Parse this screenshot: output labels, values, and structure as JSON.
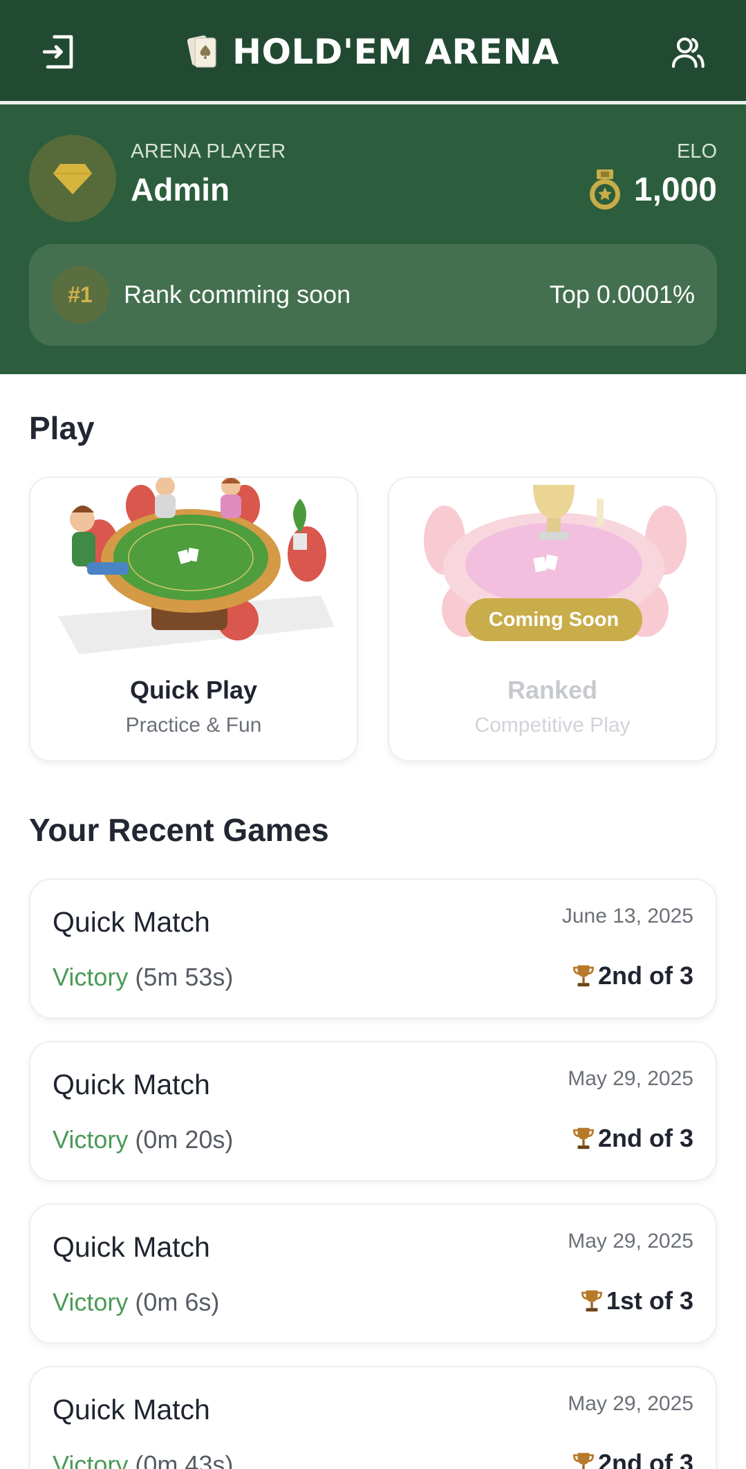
{
  "header": {
    "title": "HOLD'EM ARENA",
    "exit_icon": "exit-icon",
    "user_icon": "users-icon",
    "logo_icon": "card-spade-icon"
  },
  "profile": {
    "player_label": "ARENA PLAYER",
    "player_name": "Admin",
    "avatar_icon": "diamond-icon",
    "elo_label": "ELO",
    "elo_value": "1,000",
    "elo_icon": "medal-icon",
    "rank_badge": "#1",
    "rank_text": "Rank comming soon",
    "rank_top": "Top 0.0001%"
  },
  "play": {
    "section_title": "Play",
    "cards": [
      {
        "title": "Quick Play",
        "subtitle": "Practice & Fun"
      },
      {
        "title": "Ranked",
        "subtitle": "Competitive Play",
        "badge": "Coming Soon"
      }
    ]
  },
  "recent": {
    "section_title": "Your Recent Games",
    "games": [
      {
        "title": "Quick Match",
        "date": "June 13, 2025",
        "result": "Victory",
        "duration": "(5m 53s)",
        "place": "2nd of 3"
      },
      {
        "title": "Quick Match",
        "date": "May 29, 2025",
        "result": "Victory",
        "duration": "(0m 20s)",
        "place": "2nd of 3"
      },
      {
        "title": "Quick Match",
        "date": "May 29, 2025",
        "result": "Victory",
        "duration": "(0m 6s)",
        "place": "1st of 3"
      },
      {
        "title": "Quick Match",
        "date": "May 29, 2025",
        "result": "Victory",
        "duration": "(0m 43s)",
        "place": "2nd of 3"
      }
    ]
  },
  "colors": {
    "header_bg": "#224a32",
    "banner_bg": "#2c5e3d",
    "gold": "#c9ad4a",
    "victory": "#4a9a56"
  }
}
